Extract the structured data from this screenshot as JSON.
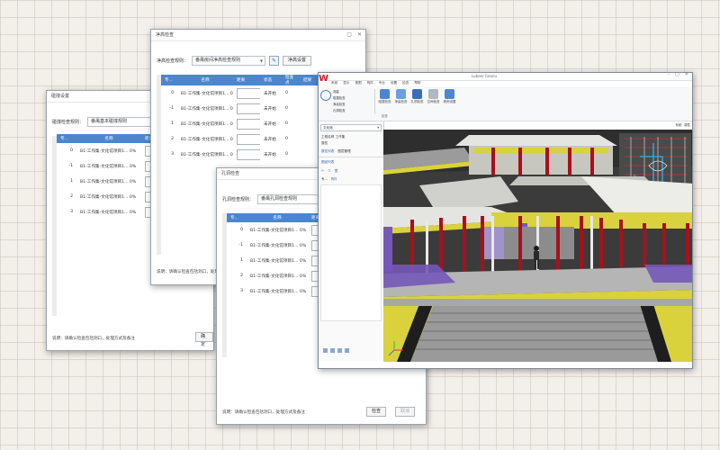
{
  "dlg_a": {
    "title": "碰撞设置",
    "rule_label": "碰撞检查规则：",
    "rule_value": "番禺基本碰撞规则",
    "columns": [
      "专...",
      "名称",
      "距离"
    ],
    "rows": [
      {
        "idx": "0",
        "name": "B1-工作集-文化馆项目1... 0%"
      },
      {
        "idx": "-1",
        "name": "B1-工作集-文化馆项目1... 0%"
      },
      {
        "idx": "1",
        "name": "B1-工作集-文化馆项目1... 0%"
      },
      {
        "idx": "2",
        "name": "B1-工作集-文化馆项目1... 0%"
      },
      {
        "idx": "3",
        "name": "B1-工作集-文化馆项目1... 0%"
      }
    ],
    "note": "说明：请确认检查包括洞口，处理方式及备注",
    "confirm_label": "确定"
  },
  "dlg_b": {
    "title": "净高检查",
    "rule_label": "净高检查规则：",
    "rule_value": "番禺房间净高检查规则",
    "settings_label": "净高设置",
    "columns": [
      "专...",
      "名称",
      "距离",
      "状态",
      "检查点",
      "结果"
    ],
    "rows": [
      {
        "idx": "0",
        "name": "B1-工作集-文化馆项目1... 0%",
        "status": "未开始",
        "count": "0"
      },
      {
        "idx": "-1",
        "name": "B1-工作集-文化馆项目1... 0%",
        "status": "未开始",
        "count": "0"
      },
      {
        "idx": "1",
        "name": "B1-工作集-文化馆项目1... 0%",
        "status": "未开始",
        "count": "0"
      },
      {
        "idx": "2",
        "name": "B1-工作集-文化馆项目1... 0%",
        "status": "未开始",
        "count": "0"
      },
      {
        "idx": "3",
        "name": "B1-工作集-文化馆项目1... 0%",
        "status": "未开始",
        "count": "0"
      }
    ],
    "note": "说明：请确认检查包括洞口，处理方"
  },
  "dlg_c": {
    "title": "孔洞检查",
    "rule_label": "孔洞检查规则：",
    "rule_value": "番禺孔洞检查规则",
    "columns": [
      "专...",
      "名称",
      "距离"
    ],
    "rows": [
      {
        "idx": "0",
        "name": "B1-工作集-文化馆项目1... 0%"
      },
      {
        "idx": "-1",
        "name": "B1-工作集-文化馆项目1... 0%"
      },
      {
        "idx": "1",
        "name": "B1-工作集-文化馆项目1... 0%"
      },
      {
        "idx": "2",
        "name": "B1-工作集-文化馆项目1... 0%"
      },
      {
        "idx": "3",
        "name": "B1-工作集-文化馆项目1... 0%"
      }
    ],
    "note": "说明：请确认检查包括洞口，处理方式及备注",
    "check_label": "检查",
    "cancel_label": "取消"
  },
  "app": {
    "title": "Lubanr Fanxiu",
    "logo": "W",
    "menu": [
      "系统",
      "显示",
      "视图",
      "构件",
      "专业",
      "设置",
      "检查",
      "帮助"
    ],
    "left_group_labels": [
      "测量",
      "碰撞检查",
      "净高检查",
      "孔洞检查"
    ],
    "tools": [
      "碰撞检查",
      "净高检查",
      "孔洞检查",
      "空间检查",
      "规则设置"
    ],
    "group_caption": "检查",
    "props": {
      "dropdown_value": "文化馆",
      "row1_label": "工程名称",
      "row1_value": "工作集",
      "section_title": "属性",
      "tabs": [
        "属性列表",
        "图层管理"
      ],
      "panel_title": "图纸列表"
    },
    "tabs_row": [
      "专...",
      "构件"
    ],
    "right_tabs": [
      "系统",
      "属性"
    ]
  },
  "colors": {
    "header_blue": "#4b86cf",
    "sky": "#3a3a3a",
    "column_red": "#a8101c",
    "floor_yellow": "#d9d23c",
    "roof_white": "#e4e4e0",
    "accent_purple": "#7658b8"
  }
}
